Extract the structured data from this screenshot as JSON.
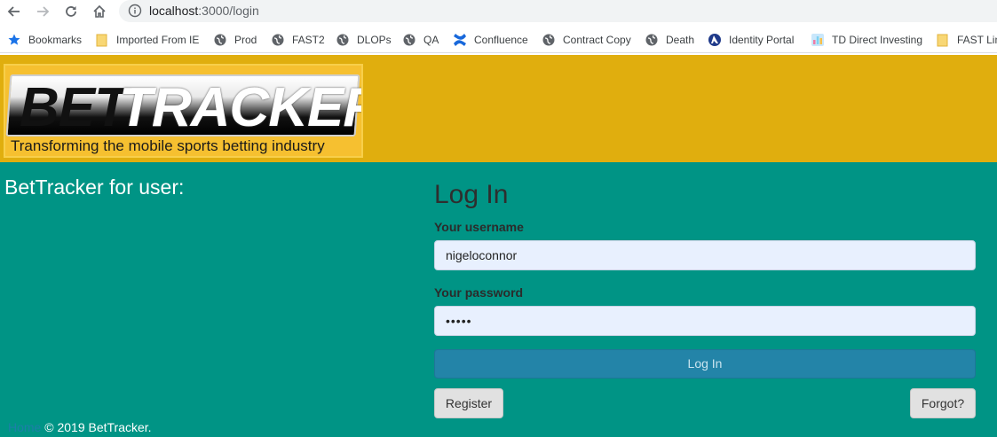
{
  "browser": {
    "url_host": "localhost",
    "url_path": ":3000/login",
    "bookmarks": [
      {
        "label": "Bookmarks",
        "icon": "star-icon"
      },
      {
        "label": "Imported From IE",
        "icon": "folder-icon"
      },
      {
        "label": "Prod",
        "icon": "globe-icon"
      },
      {
        "label": "FAST2",
        "icon": "globe-icon"
      },
      {
        "label": "DLOPs",
        "icon": "globe-icon"
      },
      {
        "label": "QA",
        "icon": "globe-icon"
      },
      {
        "label": "Confluence",
        "icon": "confluence-icon"
      },
      {
        "label": "Contract Copy",
        "icon": "globe-icon"
      },
      {
        "label": "Death",
        "icon": "globe-icon"
      },
      {
        "label": "Identity Portal",
        "icon": "identity-portal-icon"
      },
      {
        "label": "TD Direct Investing",
        "icon": "td-icon"
      },
      {
        "label": "FAST Lin",
        "icon": "folder-icon"
      }
    ]
  },
  "logo": {
    "word1": "BET",
    "word2": "TRACKER",
    "tagline": "Transforming the mobile sports betting industry"
  },
  "left": {
    "title": "BetTracker for user:"
  },
  "footer": {
    "link": "Home",
    "text": "© 2019 BetTracker."
  },
  "login": {
    "title": "Log In",
    "username_label": "Your username",
    "username_value": "nigeloconnor",
    "password_label": "Your password",
    "password_value": "•••••",
    "submit_label": "Log In",
    "register_label": "Register",
    "forgot_label": "Forgot?"
  },
  "colors": {
    "header_bg": "#e0ae0e",
    "main_bg": "#009485",
    "primary_button": "#2384a8"
  }
}
